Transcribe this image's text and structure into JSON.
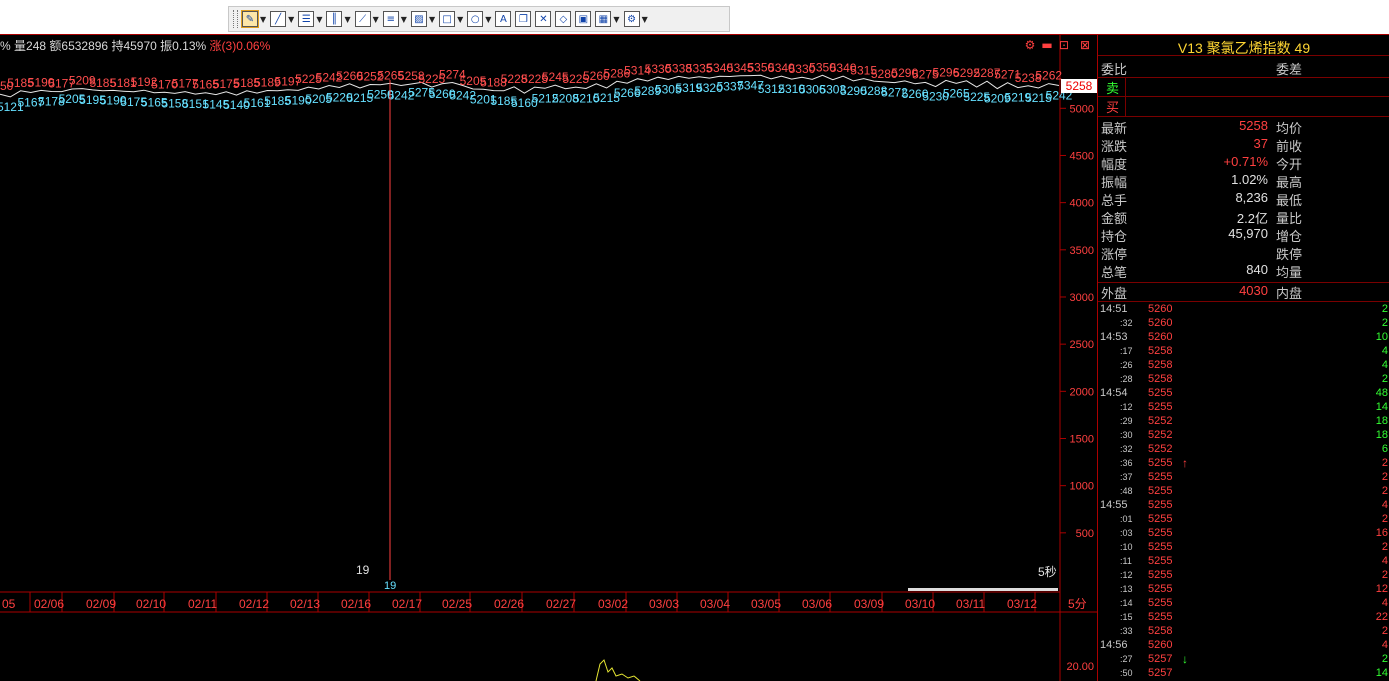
{
  "toolbar": {
    "items": [
      {
        "icon": "pencil-draw-icon",
        "active": true
      },
      {
        "icon": "line-tool-icon"
      },
      {
        "icon": "list-tool-icon"
      },
      {
        "icon": "vertical-lines-icon"
      },
      {
        "icon": "fan-lines-icon"
      },
      {
        "icon": "parallel-lines-icon"
      },
      {
        "icon": "hatch-icon"
      },
      {
        "icon": "rectangle-icon"
      },
      {
        "icon": "ellipse-icon"
      },
      {
        "icon": "text-icon",
        "glyph": "A"
      },
      {
        "icon": "copy-icon"
      },
      {
        "icon": "delete-icon"
      },
      {
        "icon": "eraser-icon"
      },
      {
        "icon": "image-icon"
      },
      {
        "icon": "palette-icon"
      },
      {
        "icon": "settings-icon"
      }
    ]
  },
  "infobar": {
    "prefix": "%",
    "volume": "量248",
    "amount": "额6532896",
    "position": "持45970",
    "amplitude": "振0.13%",
    "change": "涨(3)0.06%"
  },
  "chart_data": {
    "type": "line",
    "x_ticks": [
      "05",
      "02/06",
      "02/09",
      "02/10",
      "02/11",
      "02/12",
      "02/13",
      "02/16",
      "02/17",
      "02/25",
      "02/26",
      "02/27",
      "03/02",
      "03/03",
      "03/04",
      "03/05",
      "03/06",
      "03/09",
      "03/10",
      "03/11",
      "03/12"
    ],
    "x_tick_extra": "5分",
    "y_ticks": [
      500,
      1000,
      1500,
      2000,
      2500,
      3000,
      3500,
      4000,
      4500,
      5000
    ],
    "ylim": [
      0,
      5300
    ],
    "last_price_label": "5258",
    "marker_label_a": "19",
    "marker_label_b": "19",
    "timeframe_label": "5秒",
    "series": [
      {
        "values": [
          5150,
          5121,
          5185,
          5167,
          5190,
          5178,
          5177,
          5205,
          5209,
          5195,
          5185,
          5190,
          5181,
          5175,
          5192,
          5165,
          5170,
          5158,
          5177,
          5151,
          5165,
          5145,
          5175,
          5140,
          5185,
          5161,
          5189,
          5185,
          5197,
          5190,
          5225,
          5205,
          5242,
          5220,
          5260,
          5215,
          5252,
          5250,
          5265,
          5242,
          5258,
          5275,
          5225,
          5260,
          5274,
          5242,
          5205,
          5201,
          5188,
          5185,
          5228,
          5160,
          5225,
          5212,
          5245,
          5208,
          5225,
          5210,
          5260,
          5215,
          5286,
          5266,
          5314,
          5289,
          5330,
          5305,
          5338,
          5319,
          5335,
          5320,
          5340,
          5337,
          5345,
          5347,
          5350,
          5312,
          5340,
          5310,
          5330,
          5306,
          5350,
          5303,
          5340,
          5290,
          5315,
          5288,
          5280,
          5272,
          5290,
          5260,
          5275,
          5230,
          5296,
          5265,
          5292,
          5225,
          5287,
          5209,
          5271,
          5219,
          5238,
          5215,
          5262,
          5242
        ]
      }
    ],
    "indicator_tick": "20.00"
  },
  "panel": {
    "title": "V13  聚氯乙烯指数  49",
    "ratio_label": "委比",
    "diff_label": "委差",
    "sell_label": "卖",
    "buy_label": "买",
    "stats": [
      {
        "l": "最新",
        "v": "5258",
        "l2": "均价",
        "c": "#ff4040"
      },
      {
        "l": "涨跌",
        "v": "37",
        "l2": "前收",
        "c": "#ff4040"
      },
      {
        "l": "幅度",
        "v": "+0.71%",
        "l2": "今开",
        "c": "#ff4040"
      },
      {
        "l": "振幅",
        "v": "1.02%",
        "l2": "最高",
        "c": "#e0e0e0"
      },
      {
        "l": "总手",
        "v": "8,236",
        "l2": "最低",
        "c": "#e0e0e0"
      },
      {
        "l": "金额",
        "v": "2.2亿",
        "l2": "量比",
        "c": "#e0e0e0"
      },
      {
        "l": "持仓",
        "v": "45,970",
        "l2": "增仓",
        "c": "#e0e0e0"
      },
      {
        "l": "涨停",
        "v": "",
        "l2": "跌停",
        "c": "#e0e0e0"
      },
      {
        "l": "总笔",
        "v": "840",
        "l2": "均量",
        "c": "#e0e0e0"
      }
    ],
    "outer": {
      "l": "外盘",
      "v": "4030",
      "l2": "内盘"
    },
    "ticks": [
      {
        "t": "14:51",
        "s": false,
        "p": "5260",
        "q": "2",
        "qc": "#33ff33"
      },
      {
        "t": ":32",
        "s": true,
        "p": "5260",
        "q": "2",
        "qc": "#33ff33"
      },
      {
        "t": "14:53",
        "s": false,
        "p": "5260",
        "q": "10",
        "qc": "#33ff33"
      },
      {
        "t": ":17",
        "s": true,
        "p": "5258",
        "q": "4",
        "qc": "#33ff33"
      },
      {
        "t": ":26",
        "s": true,
        "p": "5258",
        "q": "4",
        "qc": "#33ff33"
      },
      {
        "t": ":28",
        "s": true,
        "p": "5258",
        "q": "2",
        "qc": "#33ff33"
      },
      {
        "t": "14:54",
        "s": false,
        "p": "5255",
        "q": "48",
        "qc": "#33ff33"
      },
      {
        "t": ":12",
        "s": true,
        "p": "5255",
        "q": "14",
        "qc": "#33ff33"
      },
      {
        "t": ":29",
        "s": true,
        "p": "5252",
        "q": "18",
        "qc": "#33ff33"
      },
      {
        "t": ":30",
        "s": true,
        "p": "5252",
        "q": "18",
        "qc": "#33ff33"
      },
      {
        "t": ":32",
        "s": true,
        "p": "5252",
        "q": "6",
        "qc": "#33ff33"
      },
      {
        "t": ":36",
        "s": true,
        "p": "5255",
        "arrow": "↑",
        "ac": "#ff4040",
        "q": "2",
        "qc": "#ff4040"
      },
      {
        "t": ":37",
        "s": true,
        "p": "5255",
        "q": "2",
        "qc": "#ff4040"
      },
      {
        "t": ":48",
        "s": true,
        "p": "5255",
        "q": "2",
        "qc": "#ff4040"
      },
      {
        "t": "14:55",
        "s": false,
        "p": "5255",
        "q": "4",
        "qc": "#ff4040"
      },
      {
        "t": ":01",
        "s": true,
        "p": "5255",
        "q": "2",
        "qc": "#ff4040"
      },
      {
        "t": ":03",
        "s": true,
        "p": "5255",
        "q": "16",
        "qc": "#ff4040"
      },
      {
        "t": ":10",
        "s": true,
        "p": "5255",
        "q": "2",
        "qc": "#ff4040"
      },
      {
        "t": ":11",
        "s": true,
        "p": "5255",
        "q": "4",
        "qc": "#ff4040"
      },
      {
        "t": ":12",
        "s": true,
        "p": "5255",
        "q": "2",
        "qc": "#ff4040"
      },
      {
        "t": ":13",
        "s": true,
        "p": "5255",
        "q": "12",
        "qc": "#ff4040"
      },
      {
        "t": ":14",
        "s": true,
        "p": "5255",
        "q": "4",
        "qc": "#ff4040"
      },
      {
        "t": ":15",
        "s": true,
        "p": "5255",
        "q": "22",
        "qc": "#ff4040"
      },
      {
        "t": ":33",
        "s": true,
        "p": "5258",
        "q": "2",
        "qc": "#ff4040"
      },
      {
        "t": "14:56",
        "s": false,
        "p": "5260",
        "q": "4",
        "qc": "#ff4040"
      },
      {
        "t": ":27",
        "s": true,
        "p": "5257",
        "arrow": "↓",
        "ac": "#33ff33",
        "q": "2",
        "qc": "#33ff33"
      },
      {
        "t": ":50",
        "s": true,
        "p": "5257",
        "q": "14",
        "qc": "#33ff33"
      }
    ]
  }
}
